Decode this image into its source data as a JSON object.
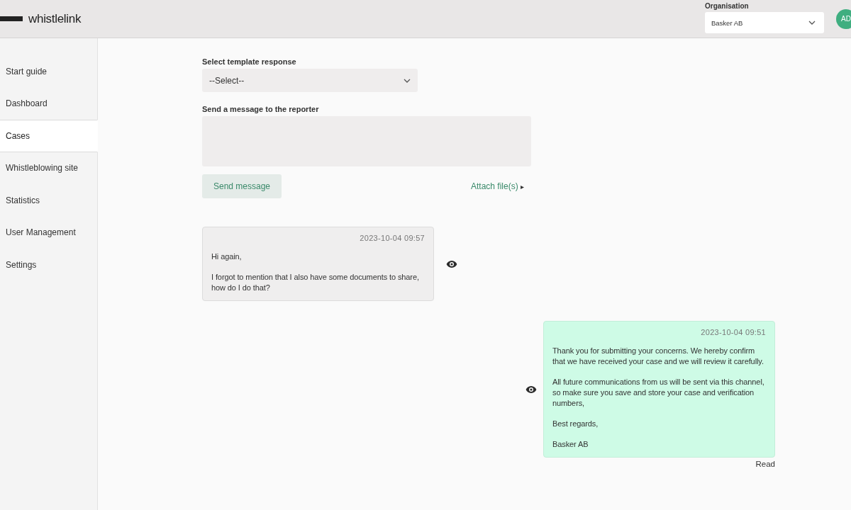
{
  "header": {
    "brand": "whistlelink",
    "organisation_label": "Organisation",
    "organisation_value": "Basker AB",
    "avatar": "AD"
  },
  "sidebar": {
    "items": [
      {
        "label": "Start guide",
        "selected": false
      },
      {
        "label": "Dashboard",
        "selected": false
      },
      {
        "label": "Cases",
        "selected": true
      },
      {
        "label": "Whistleblowing site",
        "selected": false
      },
      {
        "label": "Statistics",
        "selected": false
      },
      {
        "label": "User Management",
        "selected": false
      },
      {
        "label": "Settings",
        "selected": false
      }
    ]
  },
  "reply_form": {
    "template_label": "Select template response",
    "template_value": "--Select--",
    "message_label": "Send a message to the reporter",
    "send_button": "Send message",
    "attach_link": "Attach file(s)",
    "attach_icon": "▸"
  },
  "messages": [
    {
      "kind": "received",
      "time": "2023-10-04 09:57",
      "paragraphs": [
        "Hi again,",
        "I forgot to mention that I also have some documents to share, how do I do that?"
      ]
    },
    {
      "kind": "sent",
      "time": "2023-10-04 09:51",
      "paragraphs": [
        "Thank you for submitting your concerns. We hereby confirm that we have received your case and we will review it carefully.",
        "All future communications from us will be sent via this channel, so make sure you save and store your case and verification numbers,",
        "Best regards,",
        "Basker AB"
      ],
      "status": "Read"
    }
  ]
}
